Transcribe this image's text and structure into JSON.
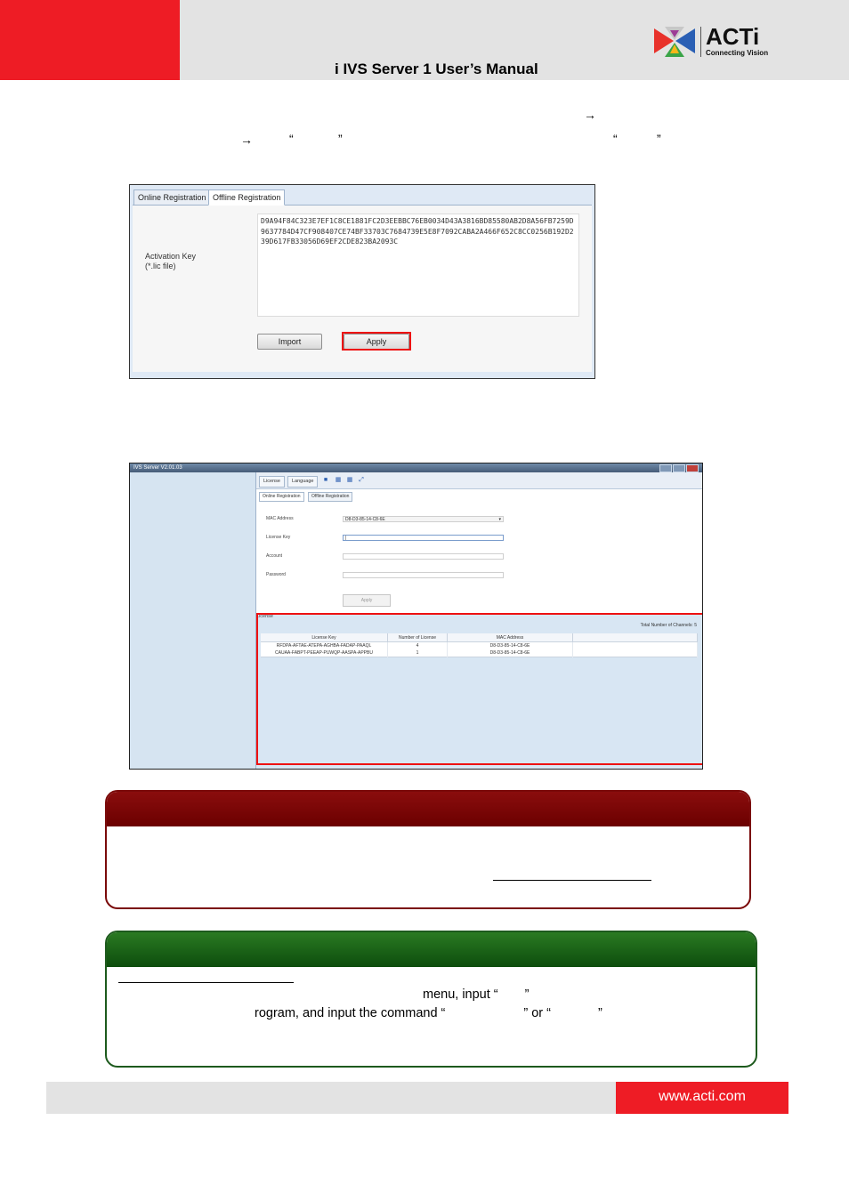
{
  "header": {
    "title": "i IVS Server 1 User’s Manual",
    "logo_word": "ACTi",
    "logo_tagline": "Connecting Vision",
    "colors": {
      "accent_red": "#ee1c25",
      "header_gray": "#e3e3e3"
    }
  },
  "intro": {
    "arrow_glyph": "→",
    "open_quote": "“",
    "close_quote": "”"
  },
  "offline_dialog": {
    "tab_online": "Online Registration",
    "tab_offline": "Offline Registration",
    "label_activation": "Activation Key",
    "label_file": "(*.lic file)",
    "activation_key": "D9A94F84C323E7EF1C8CE1881FC2D3EEBBC76EB0034D43A3816BD85580AB2D8A56FB7259D9637784D47CF908407CE74BF33703C7684739E5E8F7092CABA2A466F652C8CC0256B192D239D617FB33056D69EF2CDE823BA2093C",
    "import_label": "Import",
    "apply_label": "Apply"
  },
  "server_window": {
    "title": "IVS Server V2.01.03",
    "toolbar_tabs": [
      "License",
      "Language"
    ],
    "subtab_online": "Online Registration",
    "subtab_offline": "Offline Registration",
    "label_mac": "MAC Address",
    "label_license_key": "License Key",
    "label_account": "Account",
    "label_password": "Password",
    "mac_value": "D8-D3-85-14-C8-6E",
    "apply_label": "Apply",
    "license_section": "License",
    "total_label": "Total Number of Channels:",
    "total_value": "5",
    "table": {
      "headers": [
        "License Key",
        "Number of License",
        "MAC Address"
      ],
      "rows": [
        [
          "RFDPA-AFTAE-ATEPA-AGHBA-FADAP-PAAQL",
          "4",
          "D8-D3-85-14-C8-6E"
        ],
        [
          "CAUAA-FABPT-PEEAP-PUWQP-AASPA-APPBU",
          "1",
          "D8-D3-85-14-C8-6E"
        ]
      ]
    }
  },
  "note_tip": {
    "line_menu": "menu, input “",
    "close_quote": "”",
    "line_program": "rogram, and input the command “",
    "line_or": "” or “",
    "line_end": "”"
  },
  "footer": {
    "url": "www.acti.com"
  }
}
